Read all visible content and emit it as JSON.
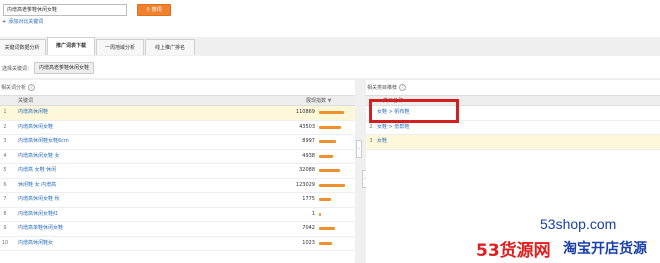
{
  "search": {
    "value": "内增高老爹鞋休闲女鞋",
    "button_label": "搜词"
  },
  "add_keyword_link": "添加对比关键词",
  "tabs": [
    {
      "label": "关键词数据分析",
      "active": false
    },
    {
      "label": "推广词表下载",
      "active": true
    },
    {
      "label": "一周地域分析",
      "active": false
    },
    {
      "label": "线上推广排名",
      "active": false
    }
  ],
  "keyword_select": {
    "label": "选择关键词：",
    "chip": "内增高老爹鞋休闲女鞋"
  },
  "left_panel": {
    "title": "相关词分析",
    "col_keyword": "关键词",
    "col_impressions": "展现指数",
    "rows": [
      {
        "num": "1",
        "keyword": "内增高休闲鞋",
        "count": "110869",
        "level": 0.95
      },
      {
        "num": "2",
        "keyword": "内增高休闲女鞋",
        "count": "43503",
        "level": 0.85
      },
      {
        "num": "3",
        "keyword": "内增高休闲鞋女鞋6cm",
        "count": "8997",
        "level": 0.65
      },
      {
        "num": "4",
        "keyword": "内增高休闲女鞋 女",
        "count": "4938",
        "level": 0.55
      },
      {
        "num": "5",
        "keyword": "内增高 女鞋 休闲",
        "count": "32088",
        "level": 0.8
      },
      {
        "num": "6",
        "keyword": "休闲鞋 女 内增高",
        "count": "123029",
        "level": 1.0
      },
      {
        "num": "7",
        "keyword": "内增高休闲女鞋 秋",
        "count": "1775",
        "level": 0.45
      },
      {
        "num": "8",
        "keyword": "内增高休闲女鞋红",
        "count": "1",
        "level": 0.06
      },
      {
        "num": "9",
        "keyword": "内增高单鞋休闲女鞋",
        "count": "7042",
        "level": 0.6
      },
      {
        "num": "10",
        "keyword": "内增高休闲鞋女",
        "count": "1023",
        "level": 0.5
      }
    ]
  },
  "right_panel": {
    "title": "相关类目推荐",
    "col_category": "类目名称",
    "rows": [
      {
        "num": "1",
        "category": "女鞋 > 帆布鞋"
      },
      {
        "num": "2",
        "category": "女鞋 > 低帮鞋"
      },
      {
        "num": "3",
        "category": "女鞋"
      }
    ]
  },
  "watermark": {
    "url": "53shop.com",
    "brand": "53货源网",
    "slogan": "淘宝开店货源"
  },
  "colors": {
    "accent": "#f0812f",
    "link": "#2a6ebb",
    "highlight_row": "#fdf8d9",
    "annotation_box": "#d21f1f"
  }
}
